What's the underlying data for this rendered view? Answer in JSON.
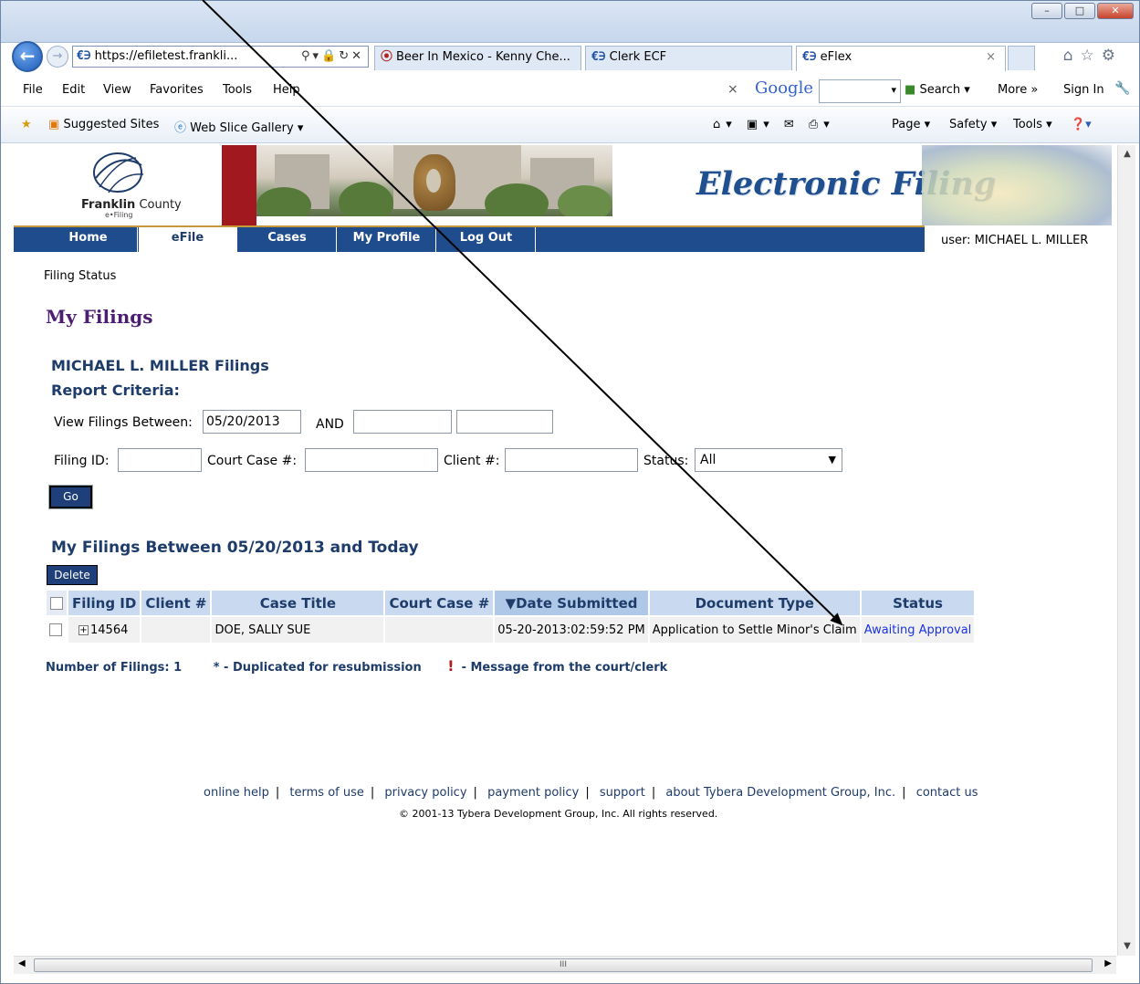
{
  "browser": {
    "address": "https://efiletest.frankli...",
    "tabs": [
      {
        "label": "Beer In Mexico - Kenny Che..."
      },
      {
        "label": "Clerk ECF"
      },
      {
        "label": "eFlex"
      }
    ],
    "menu": [
      "File",
      "Edit",
      "View",
      "Favorites",
      "Tools",
      "Help"
    ],
    "google_label": "Google",
    "search_label": "Search",
    "more_label": "More »",
    "signin_label": "Sign In",
    "favorites": {
      "suggested": "Suggested Sites",
      "webslice": "Web Slice Gallery"
    },
    "command": {
      "page": "Page",
      "safety": "Safety",
      "tools": "Tools"
    },
    "scroll_grip": "III"
  },
  "site": {
    "logo_name": "Franklin",
    "logo_county": "County",
    "logo_sub": "e•Filing",
    "banner_title": "Electronic Filing",
    "nav": [
      "Home",
      "eFile",
      "Cases",
      "My Profile",
      "Log Out"
    ],
    "user_label": "user: MICHAEL L. MILLER"
  },
  "main": {
    "breadcrumb": "Filing Status",
    "title": "My Filings",
    "filer": "MICHAEL L. MILLER Filings",
    "criteria_label": "Report Criteria:",
    "view_between_label": "View Filings Between:",
    "date_from": "05/20/2013",
    "and_label": "AND",
    "filing_id_label": "Filing ID:",
    "court_case_label": "Court Case #:",
    "client_label": "Client #:",
    "status_label": "Status:",
    "status_value": "All",
    "go_label": "Go",
    "between_title": "My Filings Between 05/20/2013 and Today",
    "delete_label": "Delete",
    "columns": [
      "Filing ID",
      "Client #",
      "Case Title",
      "Court Case #",
      "▼Date Submitted",
      "Document Type",
      "Status"
    ],
    "rows": [
      {
        "filing_id": "14564",
        "client": "",
        "case_title": "DOE, SALLY SUE",
        "court_case": "",
        "date": "05-20-2013:02:59:52 PM",
        "doc_type": "Application to Settle Minor's Claim",
        "status": "Awaiting Approval"
      }
    ],
    "count_label": "Number of Filings: 1",
    "dup_label": "* - Duplicated for resubmission",
    "msg_label": "- Message from the court/clerk"
  },
  "footer": {
    "links": [
      "online help",
      "terms of use",
      "privacy policy",
      "payment policy",
      "support",
      "about Tybera Development Group, Inc.",
      "contact us"
    ],
    "copyright": "© 2001-13 Tybera Development Group, Inc. All rights reserved."
  }
}
